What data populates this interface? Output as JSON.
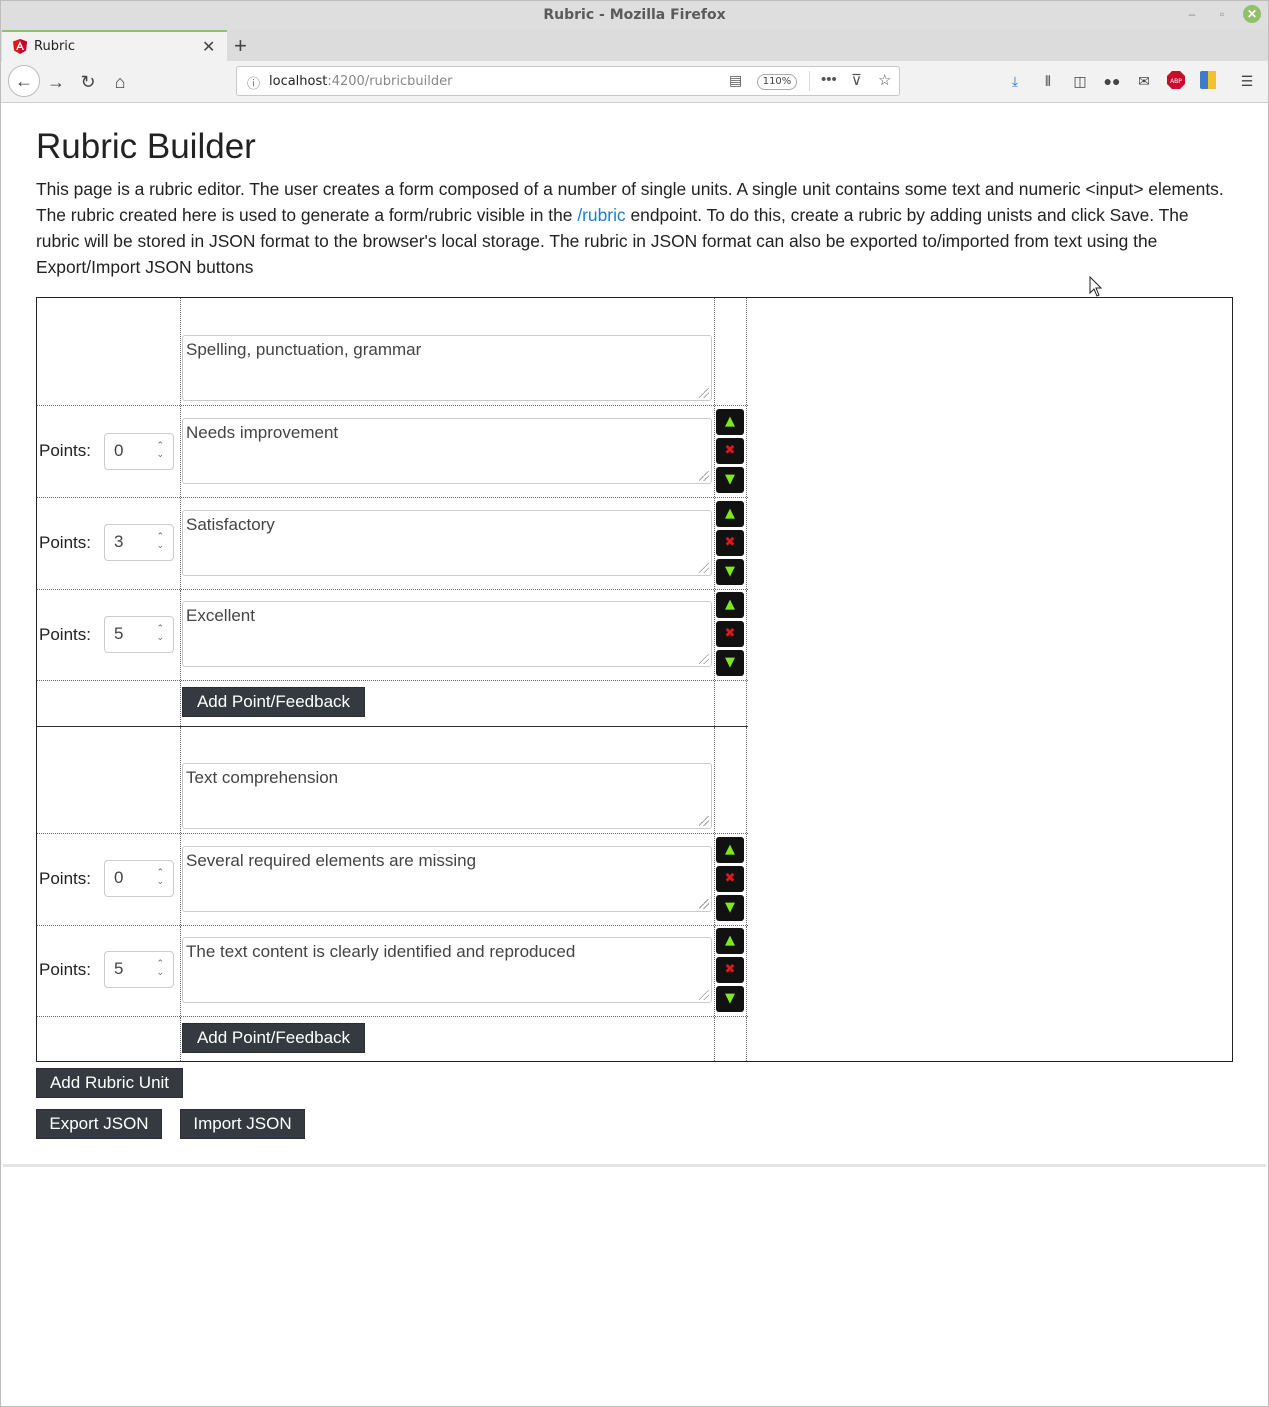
{
  "window": {
    "title": "Rubric - Mozilla Firefox",
    "minimize_glyph": "–",
    "maximize_glyph": "▫",
    "close_glyph": "✕"
  },
  "tab": {
    "title": "Rubric",
    "close_glyph": "✕",
    "new_tab_glyph": "+",
    "favicon": "angular-icon",
    "favicon_color": "#dd1b16"
  },
  "nav": {
    "back_glyph": "←",
    "forward_glyph": "→",
    "reload_glyph": "↻",
    "home_glyph": "⌂",
    "url_host": "localhost",
    "url_path": ":4200/rubricbuilder",
    "zoom": "110%",
    "icons": [
      "info-icon",
      "reader-view-icon",
      "more-icon",
      "pocket-icon",
      "bookmark-star-icon",
      "download-icon",
      "library-icon",
      "sidebar-icon",
      "incognito-icon",
      "mail-icon",
      "adblock-icon",
      "extension-icon",
      "menu-icon"
    ]
  },
  "page": {
    "heading": "Rubric Builder",
    "intro_part1": "This page is a rubric editor. The user creates a form composed of a number of single units. A single unit contains some text and numeric <input> elements. The rubric created here is used to generate a form/rubric visible in the ",
    "intro_link": "/rubric",
    "intro_part2": " endpoint. To do this, create a rubric by adding unists and click Save. The rubric will be stored in JSON format to the browser's local storage. The rubric in JSON format can also be exported to/imported from text using the Export/Import JSON buttons",
    "link_color": "#1a7fd4"
  },
  "controls": {
    "up_glyph": "▲",
    "delete_glyph": "✖",
    "down_glyph": "▼",
    "spin_glyph": "⌃⌄",
    "up_color": "#7ee81a",
    "delete_color": "#e0181b"
  },
  "units": [
    {
      "title": "Spelling, punctuation, grammar",
      "points_label": "Points:",
      "add_button": "Add Point/Feedback",
      "items": [
        {
          "points": "0",
          "feedback": "Needs improvement"
        },
        {
          "points": "3",
          "feedback": "Satisfactory"
        },
        {
          "points": "5",
          "feedback": "Excellent"
        }
      ]
    },
    {
      "title": "Text comprehension",
      "points_label": "Points:",
      "add_button": "Add Point/Feedback",
      "items": [
        {
          "points": "0",
          "feedback": "Several required elements are missing"
        },
        {
          "points": "5",
          "feedback": "The text content is clearly identified and reproduced"
        }
      ]
    }
  ],
  "actions": {
    "add_unit": "Add Rubric Unit",
    "export": "Export JSON",
    "import": "Import JSON"
  }
}
